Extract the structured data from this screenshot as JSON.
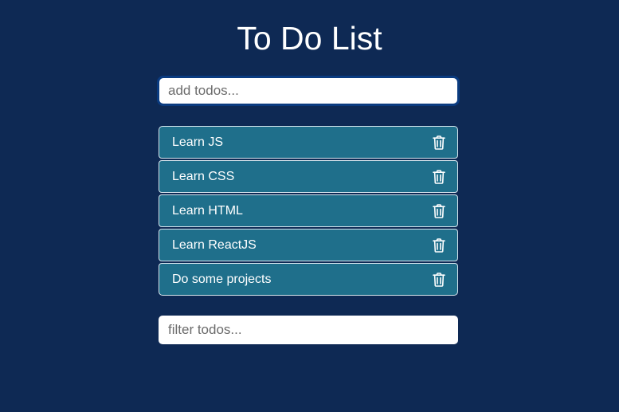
{
  "page": {
    "title": "To Do List"
  },
  "add_input": {
    "value": "",
    "placeholder": "add todos..."
  },
  "todos": [
    {
      "label": "Learn JS",
      "delete_icon": "trash-icon"
    },
    {
      "label": "Learn CSS",
      "delete_icon": "trash-icon"
    },
    {
      "label": "Learn HTML",
      "delete_icon": "trash-icon"
    },
    {
      "label": "Learn ReactJS",
      "delete_icon": "trash-icon"
    },
    {
      "label": "Do some projects",
      "delete_icon": "trash-icon"
    }
  ],
  "filter_input": {
    "value": "",
    "placeholder": "filter todos..."
  },
  "colors": {
    "background": "#0e2954",
    "item_background": "#1f6f8b",
    "item_border": "#d8e6ee",
    "add_input_border": "#0a3b80",
    "text": "#ffffff"
  }
}
